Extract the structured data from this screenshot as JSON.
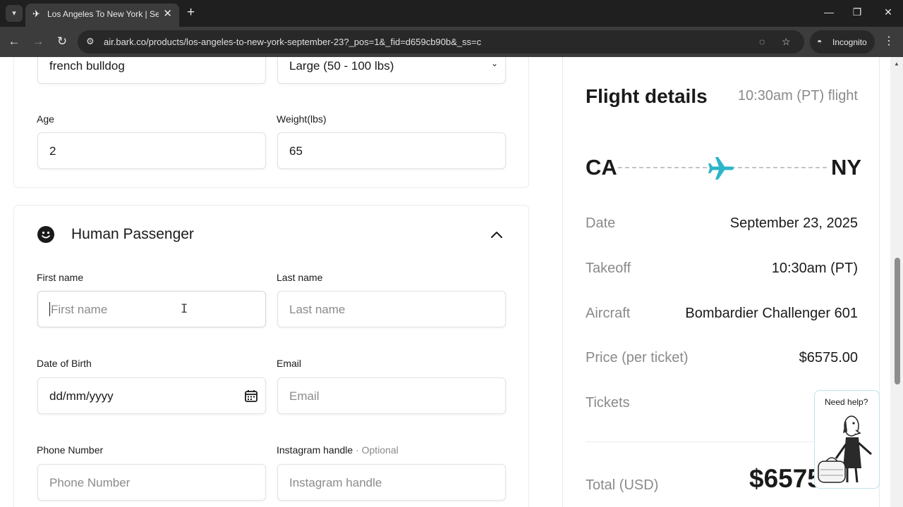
{
  "browser": {
    "tab_title": "Los Angeles To New York | September",
    "url": "air.bark.co/products/los-angeles-to-new-york-september-23?_pos=1&_fid=d659cb90b&_ss=c",
    "incognito_label": "Incognito"
  },
  "pet": {
    "breed_value": "french bulldog",
    "size_value": "Large (50 - 100 lbs)",
    "age_label": "Age",
    "age_value": "2",
    "weight_label": "Weight(lbs)",
    "weight_value": "65"
  },
  "human": {
    "section_title": "Human Passenger",
    "first_name_label": "First name",
    "first_name_placeholder": "First name",
    "last_name_label": "Last name",
    "last_name_placeholder": "Last name",
    "dob_label": "Date of Birth",
    "dob_placeholder": "dd/mm/yyyy",
    "email_label": "Email",
    "email_placeholder": "Email",
    "phone_label": "Phone Number",
    "phone_placeholder": "Phone Number",
    "instagram_label": "Instagram handle",
    "instagram_optional": "· Optional",
    "instagram_placeholder": "Instagram handle"
  },
  "flight": {
    "title": "Flight details",
    "subtitle": "10:30am (PT) flight",
    "origin": "CA",
    "destination": "NY",
    "rows": [
      {
        "label": "Date",
        "value": "September 23, 2025"
      },
      {
        "label": "Takeoff",
        "value": "10:30am (PT)"
      },
      {
        "label": "Aircraft",
        "value": "Bombardier Challenger 601"
      },
      {
        "label": "Price (per ticket)",
        "value": "$6575.00"
      },
      {
        "label": "Tickets",
        "value": ""
      }
    ],
    "total_label": "Total (USD)",
    "total_value": "$6575"
  },
  "help": {
    "label": "Need help?"
  },
  "colors": {
    "accent_plane": "#2bb5c9"
  }
}
